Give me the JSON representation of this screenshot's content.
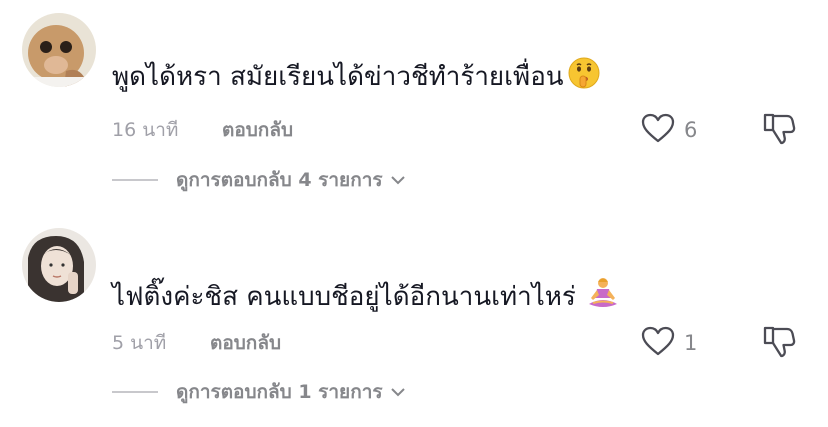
{
  "comments": [
    {
      "text": "พูดได้หรา สมัยเรียนได้ข่าวชีทำร้ายเพื่อน",
      "emoji": "shushing-face",
      "time": "16 นาที",
      "reply": "ตอบกลับ",
      "likes": "6",
      "view_replies": "ดูการตอบกลับ 4 รายการ"
    },
    {
      "text": "ไฟติ๊งค่ะชิส คนแบบชีอยู่ได้อีกนานเท่าไหร่",
      "emoji": "person-in-lotus-position",
      "time": "5 นาที",
      "reply": "ตอบกลับ",
      "likes": "1",
      "view_replies": "ดูการตอบกลับ 1 รายการ"
    }
  ],
  "colors": {
    "text": "#161823",
    "muted": "#86878b",
    "time": "#a0a0a8",
    "divider": "#c8c8cc",
    "icon": "#4c4c55"
  }
}
